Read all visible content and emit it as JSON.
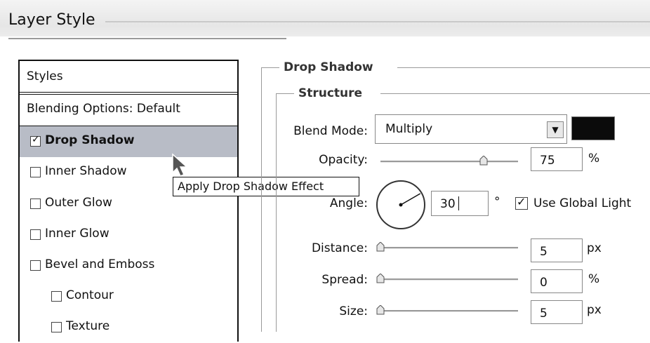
{
  "window": {
    "title": "Layer Style"
  },
  "styles_panel": {
    "header": "Styles",
    "items": [
      {
        "label": "Blending Options: Default",
        "checkbox": false,
        "checked": false,
        "selected": false
      },
      {
        "label": "Drop Shadow",
        "checkbox": true,
        "checked": true,
        "selected": true
      },
      {
        "label": "Inner Shadow",
        "checkbox": true,
        "checked": false,
        "selected": false
      },
      {
        "label": "Outer Glow",
        "checkbox": true,
        "checked": false,
        "selected": false
      },
      {
        "label": "Inner Glow",
        "checkbox": true,
        "checked": false,
        "selected": false
      },
      {
        "label": "Bevel and Emboss",
        "checkbox": true,
        "checked": false,
        "selected": false
      },
      {
        "label": "Contour",
        "checkbox": true,
        "checked": false,
        "selected": false
      },
      {
        "label": "Texture",
        "checkbox": true,
        "checked": false,
        "selected": false
      }
    ]
  },
  "tooltip": {
    "text": "Apply Drop Shadow Effect"
  },
  "drop_shadow": {
    "title": "Drop Shadow",
    "structure": {
      "title": "Structure",
      "blend_mode": {
        "label": "Blend Mode:",
        "value": "Multiply",
        "swatch_color": "#0b0b0b"
      },
      "opacity": {
        "label": "Opacity:",
        "value": "75",
        "unit": "%",
        "level": 0.75
      },
      "angle": {
        "label": "Angle:",
        "value": "30",
        "unit": "°",
        "degrees": 30
      },
      "use_global_light": {
        "label": "Use Global Light",
        "checked": true
      },
      "distance": {
        "label": "Distance:",
        "value": "5",
        "unit": "px",
        "level": 0.0
      },
      "spread": {
        "label": "Spread:",
        "value": "0",
        "unit": "%",
        "level": 0.0
      },
      "size": {
        "label": "Size:",
        "value": "5",
        "unit": "px",
        "level": 0.0
      }
    }
  }
}
